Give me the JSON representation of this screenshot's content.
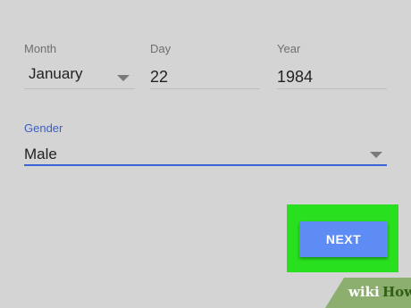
{
  "birthday": {
    "month": {
      "label": "Month",
      "value": "January"
    },
    "day": {
      "label": "Day",
      "value": "22"
    },
    "year": {
      "label": "Year",
      "value": "1984"
    }
  },
  "gender": {
    "label": "Gender",
    "value": "Male"
  },
  "actions": {
    "next_label": "NEXT"
  },
  "watermark": {
    "wiki": "wiki",
    "how": "How"
  },
  "colors": {
    "background": "#d4d4d4",
    "accent": "#3a63d8",
    "button": "#5d8cf4",
    "highlight": "#28e01e"
  }
}
